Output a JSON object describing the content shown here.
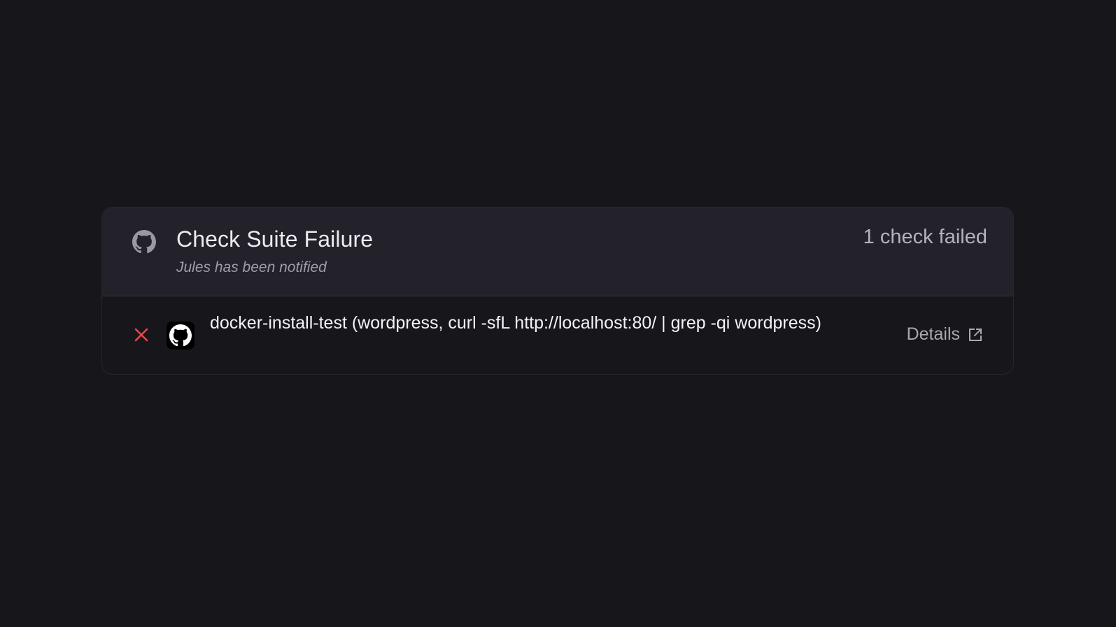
{
  "header": {
    "title": "Check Suite Failure",
    "subtitle": "Jules has been notified",
    "status": "1 check failed",
    "icon": "github-icon"
  },
  "checks": [
    {
      "status": "failed",
      "status_icon": "close-icon",
      "app_icon": "github-icon",
      "name": "docker-install-test (wordpress, curl -sfL http://localhost:80/ | grep -qi wordpress)",
      "details_label": "Details",
      "details_icon": "external-link-icon"
    }
  ],
  "colors": {
    "background": "#17161b",
    "header_background": "#23222b",
    "failure": "#e5484d",
    "text_primary": "#ecebf1",
    "text_muted": "#9f9ea8"
  }
}
